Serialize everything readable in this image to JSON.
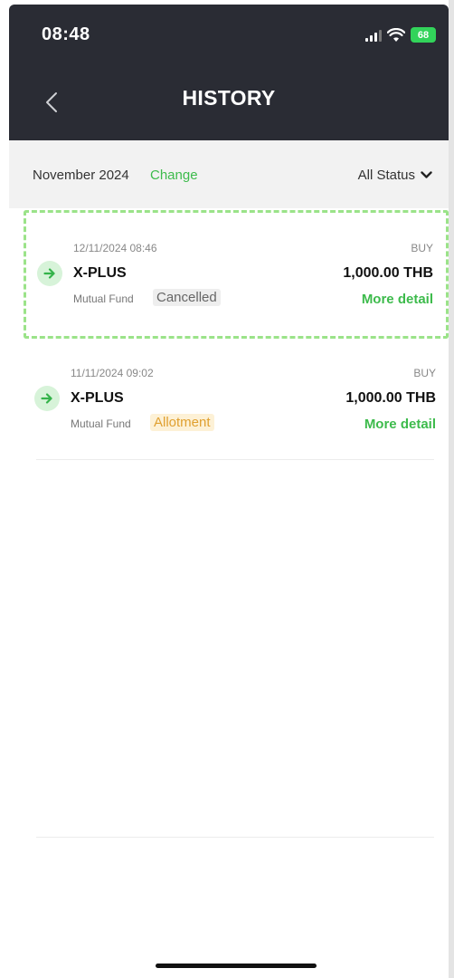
{
  "status_bar": {
    "time": "08:48",
    "battery": "68"
  },
  "header": {
    "title": "HISTORY"
  },
  "filter": {
    "month": "November 2024",
    "change_label": "Change",
    "status_label": "All Status"
  },
  "transactions": [
    {
      "datetime": "12/11/2024 08:46",
      "type": "BUY",
      "fund": "X-PLUS",
      "amount": "1,000.00 THB",
      "category": "Mutual Fund",
      "status": "Cancelled",
      "more_label": "More detail",
      "icon": "arrow-right-icon"
    },
    {
      "datetime": "11/11/2024 09:02",
      "type": "BUY",
      "fund": "X-PLUS",
      "amount": "1,000.00 THB",
      "category": "Mutual Fund",
      "status": "Allotment",
      "more_label": "More detail",
      "icon": "arrow-right-icon"
    }
  ],
  "colors": {
    "header_bg": "#2a2c34",
    "accent_green": "#3dbb4c",
    "highlight_border": "#9be389",
    "allotment_text": "#e0a030",
    "allotment_bg": "#fdf1d6",
    "cancelled_bg": "#eeeeee"
  }
}
